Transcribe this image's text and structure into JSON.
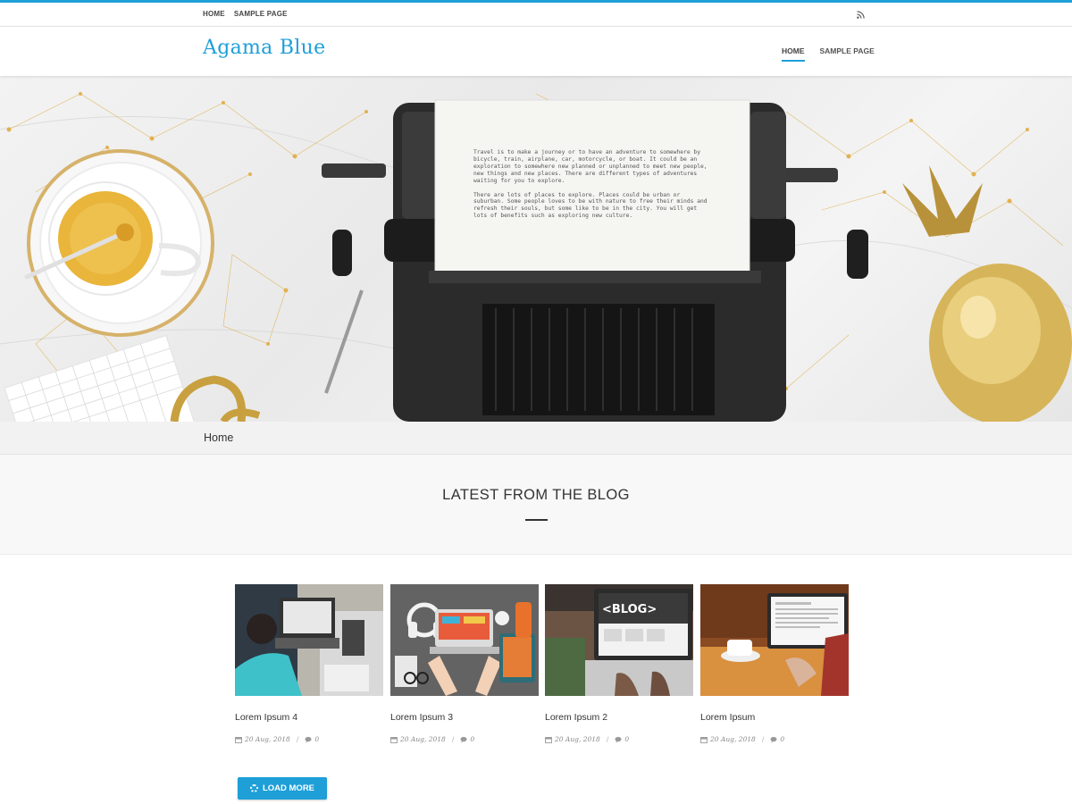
{
  "topbar": {
    "nav": [
      "HOME",
      "SAMPLE PAGE"
    ],
    "rss_icon": "rss-icon"
  },
  "header": {
    "brand": "Agama Blue",
    "nav": [
      {
        "label": "HOME",
        "active": true
      },
      {
        "label": "SAMPLE PAGE",
        "active": false
      }
    ]
  },
  "hero": {
    "paragraphs": [
      "Travel is to make a journey or to have an adventure to somewhere by bicycle, train, airplane, car, motorcycle, or boat. It could be an exploration to somewhere new planned or unplanned to meet new people, new things and new places. There are different types of adventures waiting for you to explore.",
      "There are lots of places to explore. Places could be urban or suburban. Some people loves to be with nature to free their minds and refresh their souls, but some like to be in the city. You will get lots of benefits such as exploring new culture."
    ],
    "accent_color": "#e0a83a"
  },
  "breadcrumb": "Home",
  "section": {
    "title": "LATEST FROM THE BLOG"
  },
  "posts": [
    {
      "title": "Lorem Ipsum 4",
      "date": "20 Aug, 2018",
      "comments": "0"
    },
    {
      "title": "Lorem Ipsum 3",
      "date": "20 Aug, 2018",
      "comments": "0"
    },
    {
      "title": "Lorem Ipsum 2",
      "date": "20 Aug, 2018",
      "comments": "0"
    },
    {
      "title": "Lorem Ipsum",
      "date": "20 Aug, 2018",
      "comments": "0"
    }
  ],
  "load_more": {
    "label": "LOAD MORE",
    "icon": "spinner-icon"
  },
  "colors": {
    "accent": "#1e9fd8",
    "text": "#333333"
  }
}
